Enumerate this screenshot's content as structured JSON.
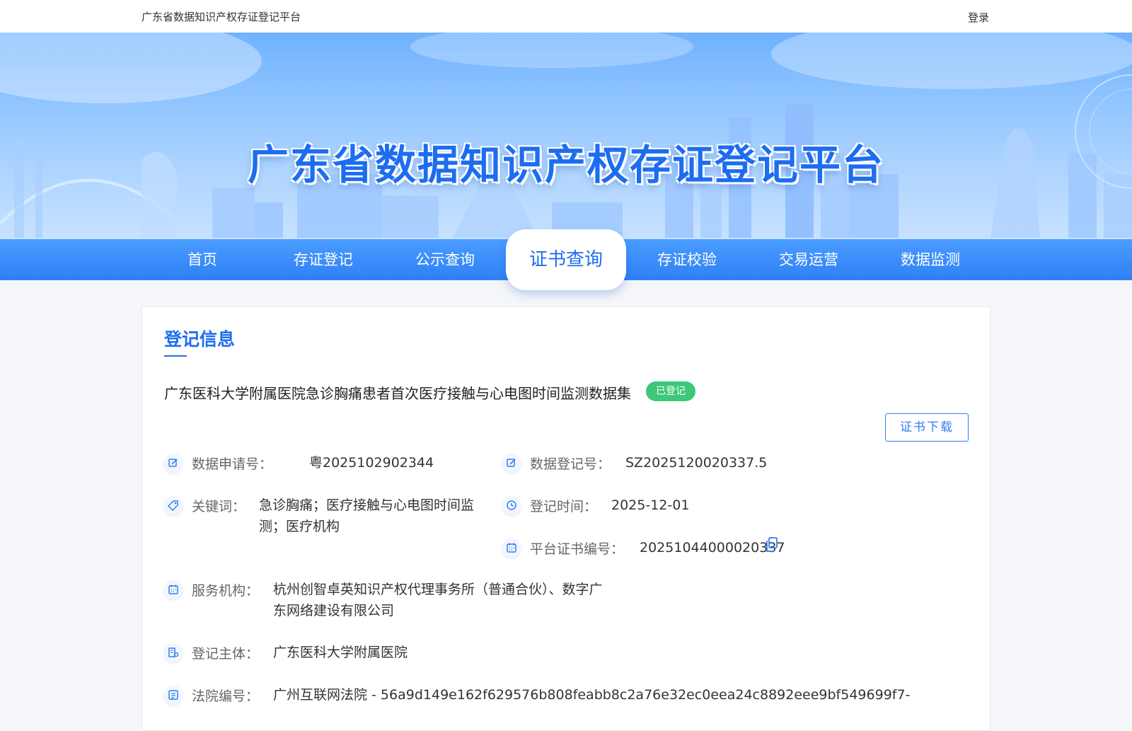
{
  "topbar": {
    "site_name": "广东省数据知识产权存证登记平台",
    "login": "登录"
  },
  "banner": {
    "title": "广东省数据知识产权存证登记平台"
  },
  "nav": {
    "items": [
      {
        "label": "首页"
      },
      {
        "label": "存证登记"
      },
      {
        "label": "公示查询"
      },
      {
        "label": "证书查询"
      },
      {
        "label": "存证校验"
      },
      {
        "label": "交易运营"
      },
      {
        "label": "数据监测"
      }
    ],
    "active": "证书查询"
  },
  "section": {
    "title": "登记信息"
  },
  "dataset": {
    "title": "广东医科大学附属医院急诊胸痛患者首次医疗接触与心电图时间监测数据集",
    "status": "已登记",
    "download_label": "证书下载"
  },
  "fields": {
    "application_no": {
      "label": "数据申请号：",
      "value": "粤2025102902344"
    },
    "registration_no": {
      "label": "数据登记号：",
      "value": "SZ2025120020337.5"
    },
    "keywords": {
      "label": "关键词：",
      "value_line1": "急诊胸痛；医疗接触与心电图时间监",
      "value_line2": "测；医疗机构"
    },
    "registration_time": {
      "label": "登记时间：",
      "value": "2025-12-01"
    },
    "certificate_no": {
      "label": "平台证书编号：",
      "value": "20251044000020337"
    },
    "service_org": {
      "label": "服务机构：",
      "value_line1": "杭州创智卓英知识产权代理事务所（普通合伙）、数字广",
      "value_line2": "东网络建设有限公司"
    },
    "registrant": {
      "label": "登记主体：",
      "value": "广东医科大学附属医院"
    },
    "court_no": {
      "label": "法院编号：",
      "value": "广州互联网法院 - 56a9d149e162f629576b808feabb8c2a76e32ec0eea24c8892eee9bf549699f7-"
    }
  },
  "colors": {
    "primary": "#1d6df0",
    "nav": "#2f7ff5",
    "badge": "#3ec77a"
  }
}
